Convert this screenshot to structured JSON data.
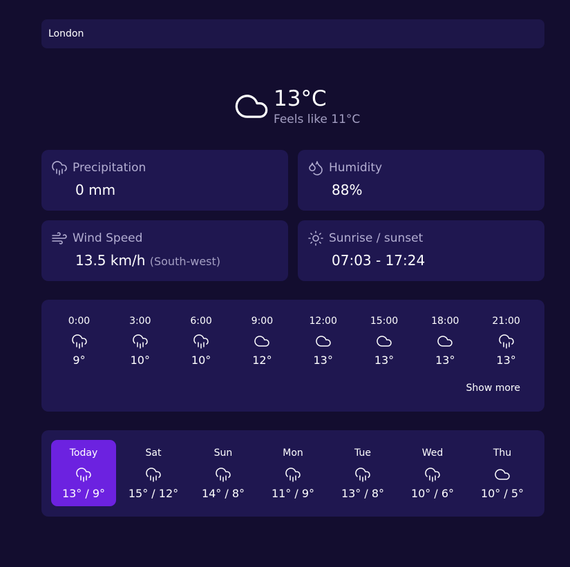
{
  "search": {
    "value": "London"
  },
  "current": {
    "icon": "cloud-icon",
    "temperature": "13°C",
    "feels_like": "Feels like 11°C"
  },
  "stats": {
    "precipitation": {
      "label": "Precipitation",
      "value": "0 mm",
      "icon": "rain-cloud-icon"
    },
    "humidity": {
      "label": "Humidity",
      "value": "88%",
      "icon": "droplets-icon"
    },
    "wind": {
      "label": "Wind Speed",
      "value": "13.5 km/h",
      "direction": "(South-west)",
      "icon": "wind-icon"
    },
    "sun": {
      "label": "Sunrise / sunset",
      "value": "07:03 - 17:24",
      "icon": "sun-icon"
    }
  },
  "hourly": [
    {
      "time": "0:00",
      "icon": "rain-cloud-icon",
      "temp": "9°"
    },
    {
      "time": "3:00",
      "icon": "rain-cloud-icon",
      "temp": "10°"
    },
    {
      "time": "6:00",
      "icon": "rain-cloud-icon",
      "temp": "10°"
    },
    {
      "time": "9:00",
      "icon": "cloud-icon",
      "temp": "12°"
    },
    {
      "time": "12:00",
      "icon": "cloud-icon",
      "temp": "13°"
    },
    {
      "time": "15:00",
      "icon": "cloud-icon",
      "temp": "13°"
    },
    {
      "time": "18:00",
      "icon": "cloud-icon",
      "temp": "13°"
    },
    {
      "time": "21:00",
      "icon": "rain-cloud-icon",
      "temp": "13°"
    }
  ],
  "show_more_label": "Show more",
  "daily": [
    {
      "day": "Today",
      "icon": "rain-cloud-icon",
      "range": "13° / 9°",
      "active": true
    },
    {
      "day": "Sat",
      "icon": "rain-cloud-icon",
      "range": "15° / 12°"
    },
    {
      "day": "Sun",
      "icon": "rain-cloud-icon",
      "range": "14° / 8°"
    },
    {
      "day": "Mon",
      "icon": "rain-cloud-icon",
      "range": "11° / 9°"
    },
    {
      "day": "Tue",
      "icon": "rain-cloud-icon",
      "range": "13° / 8°"
    },
    {
      "day": "Wed",
      "icon": "rain-cloud-icon",
      "range": "10° / 6°"
    },
    {
      "day": "Thu",
      "icon": "cloud-icon",
      "range": "10° / 5°"
    }
  ],
  "colors": {
    "background": "#130d2f",
    "card": "#1f1750",
    "accent": "#6c22e0",
    "muted_text": "#a49fc3"
  }
}
